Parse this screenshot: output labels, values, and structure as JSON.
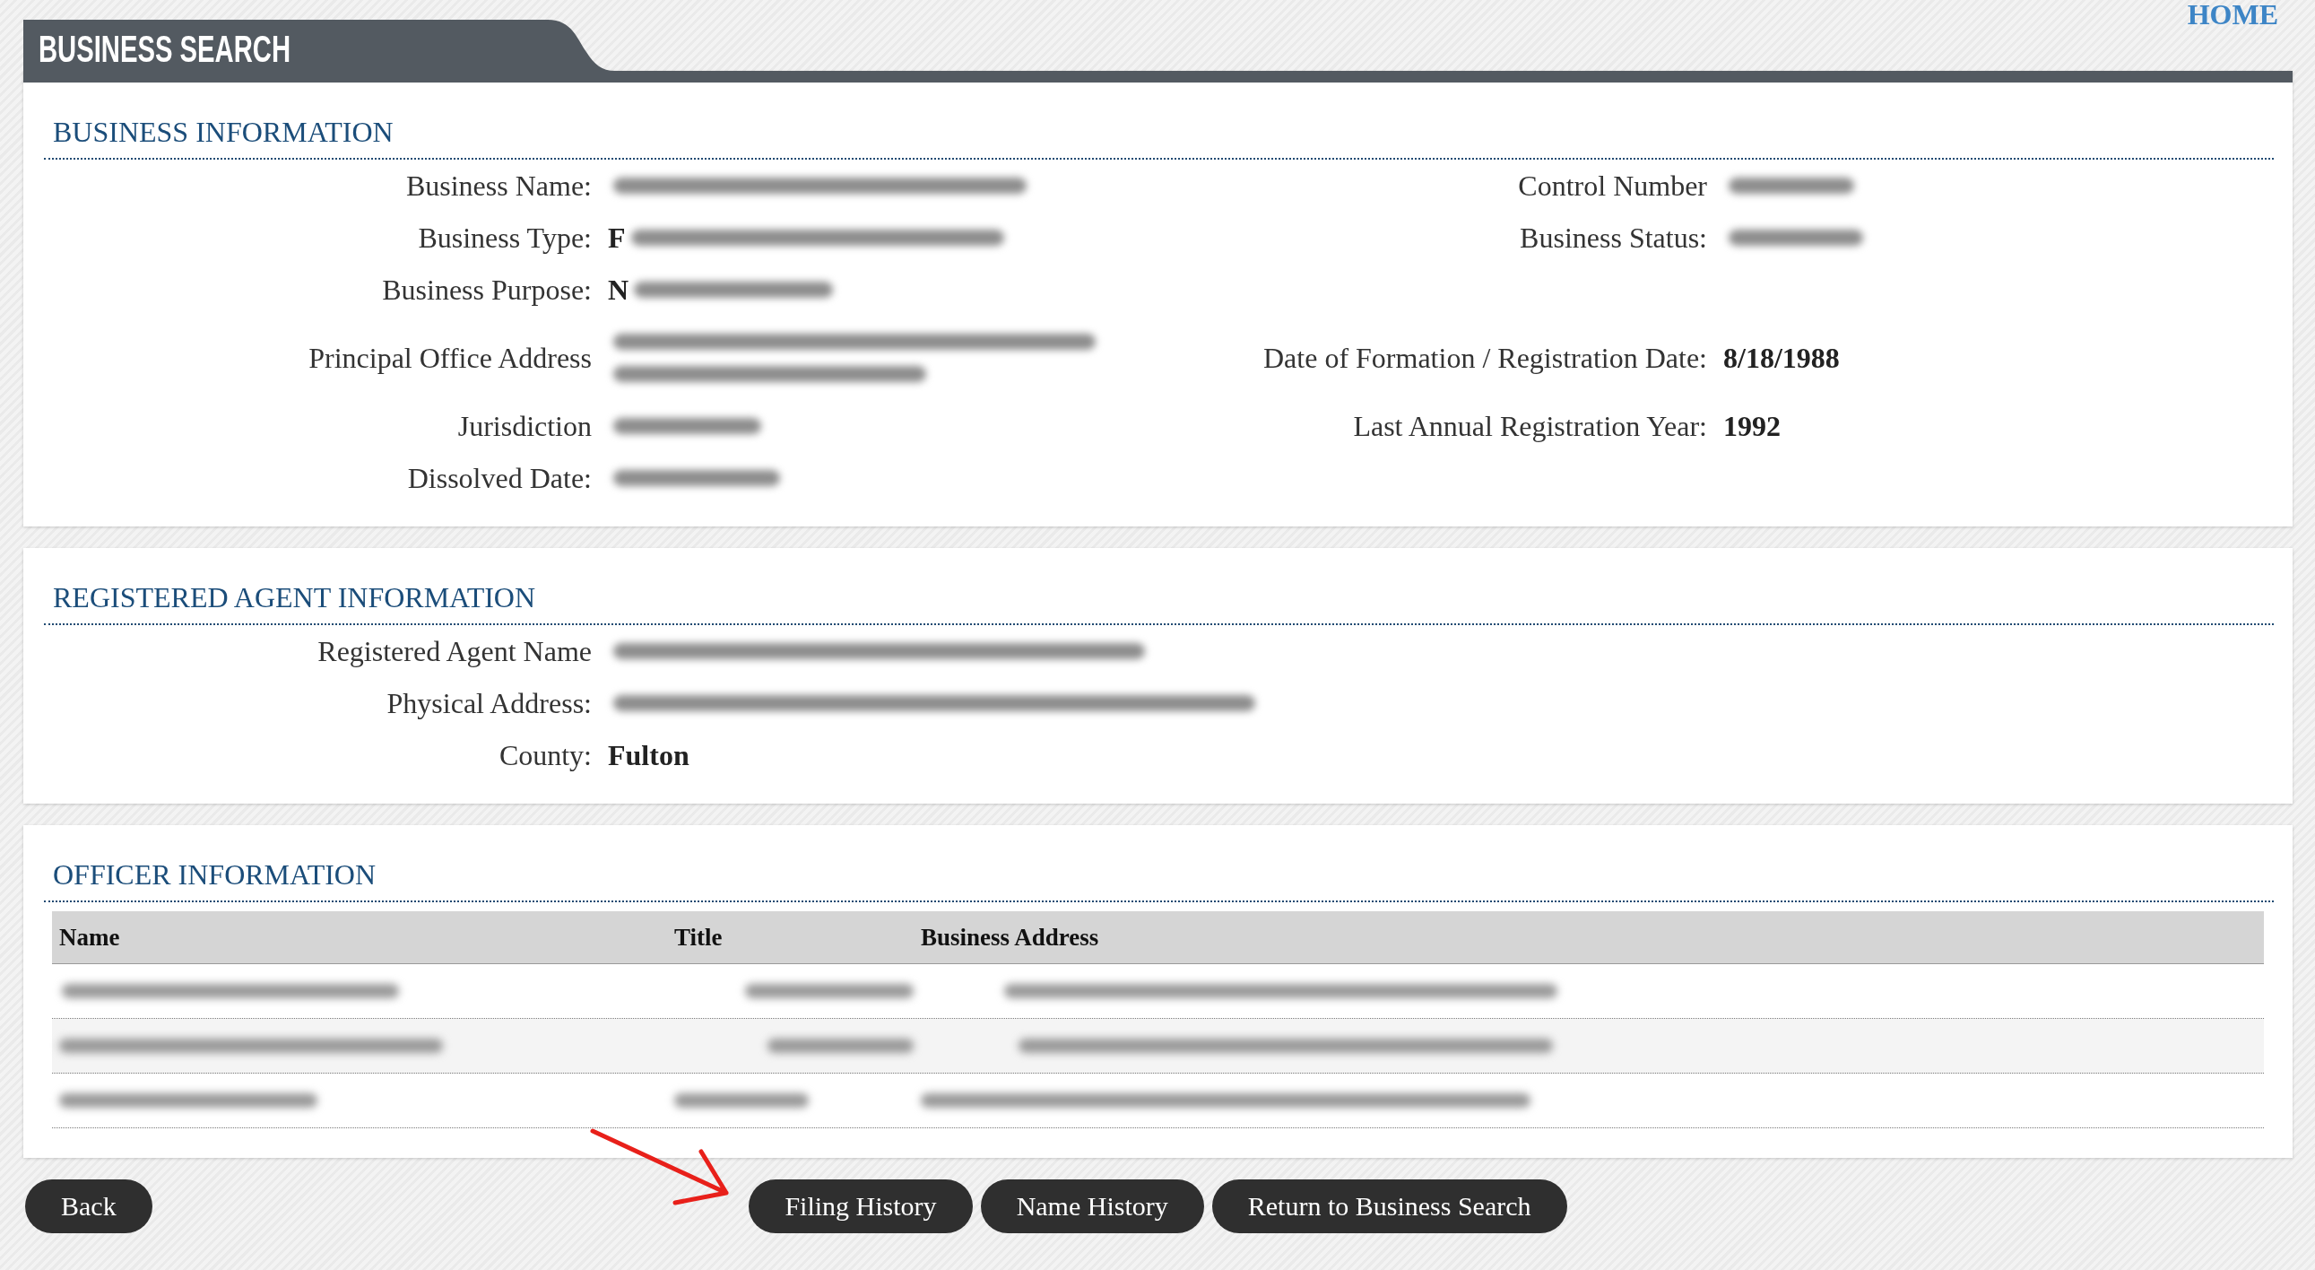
{
  "header": {
    "title": "BUSINESS SEARCH",
    "home_link": "HOME"
  },
  "sections": [
    {
      "kind": "fields",
      "title": "BUSINESS INFORMATION",
      "rows": [
        {
          "fields": [
            {
              "label": "Business Name:",
              "redacted": true
            },
            {
              "label": "Control Number",
              "redacted": true
            }
          ]
        },
        {
          "fields": [
            {
              "label": "Business Type:",
              "value": "F",
              "redacted": true
            },
            {
              "label": "Business Status:",
              "redacted": true
            }
          ]
        },
        {
          "fields": [
            {
              "label": "Business Purpose:",
              "value": "N",
              "redacted": true
            }
          ]
        },
        {
          "fields": [
            {
              "label": "Principal Office Address",
              "redacted": true
            },
            {
              "label": "Date of Formation / Registration Date:",
              "value": "8/18/1988",
              "redacted": false
            }
          ]
        },
        {
          "fields": [
            {
              "label": "Jurisdiction",
              "redacted": true
            },
            {
              "label": "Last Annual Registration Year:",
              "value": "1992",
              "redacted": false
            }
          ]
        },
        {
          "fields": [
            {
              "label": "Dissolved Date:",
              "redacted": true
            }
          ]
        }
      ]
    },
    {
      "kind": "fields",
      "title": "REGISTERED AGENT INFORMATION",
      "rows": [
        {
          "fields": [
            {
              "label": "Registered Agent Name",
              "redacted": true
            }
          ]
        },
        {
          "fields": [
            {
              "label": "Physical Address:",
              "redacted": true
            }
          ]
        },
        {
          "fields": [
            {
              "label": "County:",
              "value": "Fulton",
              "redacted": false
            }
          ]
        }
      ]
    },
    {
      "kind": "table",
      "title": "OFFICER INFORMATION",
      "columns": [
        "Name",
        "Title",
        "Business Address"
      ],
      "rows": [
        {
          "cells": [
            {
              "redacted": true
            },
            {
              "redacted": true
            },
            {
              "redacted": true
            }
          ]
        },
        {
          "cells": [
            {
              "redacted": true
            },
            {
              "redacted": true
            },
            {
              "redacted": true
            }
          ]
        },
        {
          "cells": [
            {
              "redacted": true
            },
            {
              "redacted": true
            },
            {
              "redacted": true
            }
          ]
        }
      ]
    }
  ],
  "footer": {
    "back_button": "Back",
    "buttons": [
      "Filing History",
      "Name History",
      "Return to Business Search"
    ]
  },
  "annotations": [
    {
      "kind": "arrow"
    }
  ]
}
